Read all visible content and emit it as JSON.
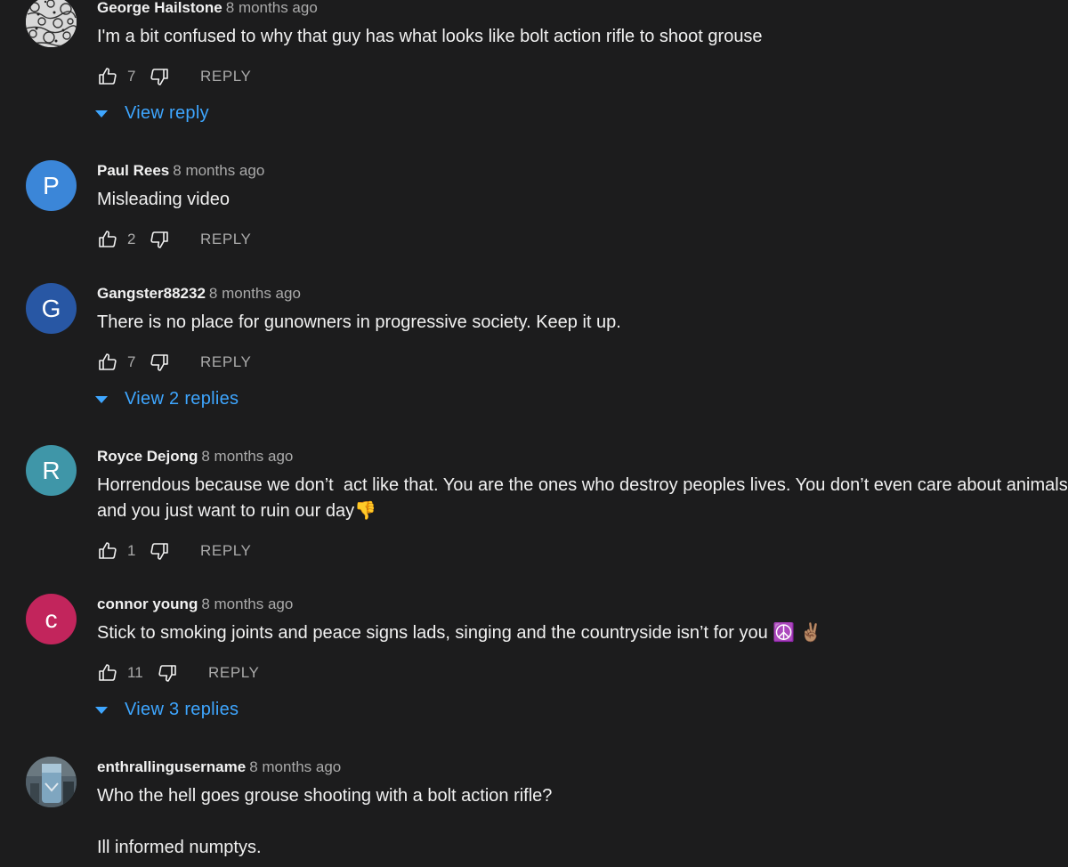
{
  "comments": [
    {
      "author": "George Hailstone",
      "time": "8 months ago",
      "text": "I'm a bit confused to why that guy has what looks like bolt action rifle to shoot grouse",
      "likes": "7",
      "reply_label": "REPLY",
      "view_replies": "View reply",
      "avatar_type": "image-bw-pattern"
    },
    {
      "author": "Paul Rees",
      "time": "8 months ago",
      "text": "Misleading video",
      "likes": "2",
      "reply_label": "REPLY",
      "avatar_letter": "P",
      "avatar_color": "#3b86d8"
    },
    {
      "author": "Gangster88232",
      "time": "8 months ago",
      "text": "There is no place for gunowners in progressive society. Keep it up.",
      "likes": "7",
      "reply_label": "REPLY",
      "view_replies": "View 2 replies",
      "avatar_letter": "G",
      "avatar_color": "#2857a4"
    },
    {
      "author": "Royce Dejong",
      "time": "8 months ago",
      "text": "Horrendous because we don’t  act like that. You are the ones who destroy peoples lives. You don’t even care about animals and you just want to ruin our day👎",
      "likes": "1",
      "reply_label": "REPLY",
      "avatar_letter": "R",
      "avatar_color": "#3f96a8"
    },
    {
      "author": "connor young",
      "time": "8 months ago",
      "text": "Stick to smoking joints and peace signs lads, singing and the countryside isn’t for you ☮️ ✌🏽",
      "likes": "11",
      "reply_label": "REPLY",
      "view_replies": "View 3 replies",
      "avatar_letter": "c",
      "avatar_color": "#c2255c"
    },
    {
      "author": "enthrallingusername",
      "time": "8 months ago",
      "text": "Who the hell goes grouse shooting with a bolt action rifle?\n\nIll informed numptys.",
      "avatar_type": "image-photo"
    }
  ],
  "icons": {
    "like": "thumb-up-outline-icon",
    "dislike": "thumb-down-outline-icon",
    "expand": "triangle-down-icon"
  },
  "colors": {
    "background": "#1c1c1d",
    "link_blue": "#3ea6ff",
    "secondary_text": "#aaaaaa"
  }
}
